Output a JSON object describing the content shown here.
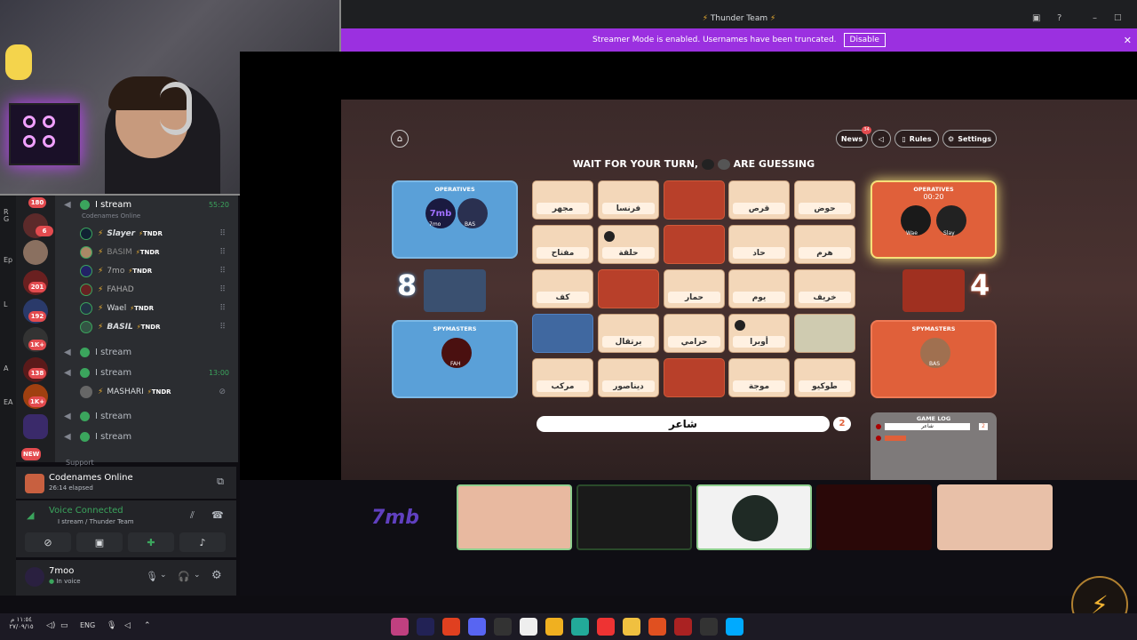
{
  "window": {
    "title": "Thunder Team"
  },
  "streamer_banner": {
    "text": "Streamer Mode is enabled. Usernames have been truncated.",
    "button": "Disable"
  },
  "sidebar_strip": {
    "labels": [
      "R",
      "G",
      "Ep",
      "L",
      "A",
      "EA"
    ]
  },
  "guilds": {
    "badges": [
      "180",
      "6",
      "201",
      "192",
      "1K+",
      "138",
      "1K+",
      "NEW"
    ]
  },
  "channels": [
    {
      "name": "I stream",
      "time": "55:20",
      "activity": "Codenames Online"
    },
    {
      "name": "I stream",
      "time": ""
    },
    {
      "name": "I stream",
      "time": "13:00"
    },
    {
      "name": "I stream",
      "time": ""
    },
    {
      "name": "I stream",
      "time": ""
    }
  ],
  "users_ch1": [
    {
      "name": "Slayer",
      "tag": "TNDR"
    },
    {
      "name": "BASIM",
      "tag": "TNDR"
    },
    {
      "name": "7mo",
      "tag": "TNDR"
    },
    {
      "name": "FAHAD",
      "tag": ""
    },
    {
      "name": "Wael",
      "tag": "TNDR"
    },
    {
      "name": "BASIL",
      "tag": "TNDR"
    }
  ],
  "users_ch3": [
    {
      "name": "MASHARI",
      "tag": "TNDR"
    }
  ],
  "support": "Support",
  "activity": {
    "title": "Codenames Online",
    "elapsed": "26:14 elapsed"
  },
  "voice": {
    "status": "Voice Connected",
    "channel": "I stream / Thunder Team"
  },
  "user": {
    "name": "7moo",
    "status": "In voice"
  },
  "game": {
    "nav": {
      "news": "News",
      "news_badge": "34",
      "rules": "Rules",
      "settings": "Settings"
    },
    "wait_left": "WAIT FOR YOUR TURN,",
    "wait_right": "ARE GUESSING",
    "blue_ops": {
      "title": "OPERATIVES",
      "players": [
        "7mo",
        "BAS"
      ],
      "logo": "7mb"
    },
    "blue_spy": {
      "title": "SPYMASTERS",
      "players": [
        "FAH"
      ]
    },
    "red_ops": {
      "title": "OPERATIVES",
      "timer": "00:20",
      "players": [
        "Wae",
        "Slay"
      ]
    },
    "red_spy": {
      "title": "SPYMASTERS",
      "players": [
        "BAS"
      ]
    },
    "blue_score": "8",
    "red_score": "4",
    "cards": [
      {
        "word": "مجهر",
        "type": "plain"
      },
      {
        "word": "فرنسا",
        "type": "plain"
      },
      {
        "word": "",
        "type": "red"
      },
      {
        "word": "قرص",
        "type": "plain"
      },
      {
        "word": "حوض",
        "type": "plain"
      },
      {
        "word": "مفتاح",
        "type": "plain"
      },
      {
        "word": "حلقة",
        "type": "plain",
        "chip": true
      },
      {
        "word": "",
        "type": "red"
      },
      {
        "word": "حاد",
        "type": "plain"
      },
      {
        "word": "هرم",
        "type": "plain"
      },
      {
        "word": "كف",
        "type": "plain"
      },
      {
        "word": "",
        "type": "red"
      },
      {
        "word": "حمار",
        "type": "plain"
      },
      {
        "word": "يوم",
        "type": "plain"
      },
      {
        "word": "خريف",
        "type": "plain"
      },
      {
        "word": "",
        "type": "blue"
      },
      {
        "word": "برتقال",
        "type": "plain"
      },
      {
        "word": "حرامي",
        "type": "plain"
      },
      {
        "word": "أوبرا",
        "type": "plain",
        "chip": true
      },
      {
        "word": "",
        "type": "neutral"
      },
      {
        "word": "مركب",
        "type": "plain"
      },
      {
        "word": "ديناصور",
        "type": "plain"
      },
      {
        "word": "",
        "type": "red"
      },
      {
        "word": "موجة",
        "type": "plain"
      },
      {
        "word": "طوكيو",
        "type": "plain"
      }
    ],
    "clue": {
      "word": "شاعر",
      "number": "2"
    },
    "game_log": {
      "title": "GAME LOG",
      "entry": "شاعر",
      "entry_num": "2"
    }
  },
  "taskbar": {
    "time": "١١:٥٤ م",
    "date": "٢٧/٠٩/١٥",
    "lang": "ENG"
  },
  "colors": {
    "blue": "#5aa0d8",
    "red": "#e0603a",
    "purple": "#9b30e0",
    "green": "#3ba55d"
  }
}
